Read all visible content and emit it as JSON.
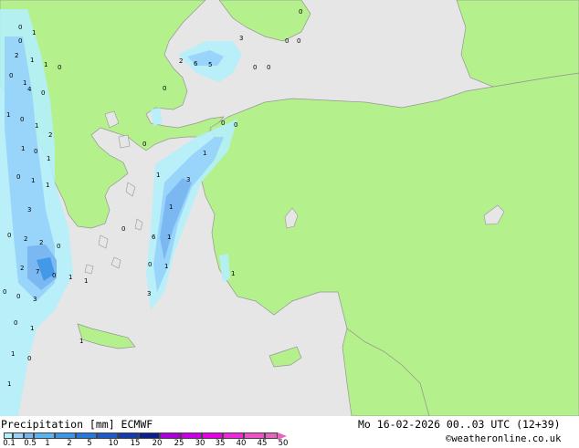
{
  "map": {
    "labels": [
      "0",
      "1",
      "0",
      "2",
      "1",
      "1",
      "0",
      "0",
      "1",
      "4",
      "0",
      "1",
      "0",
      "1",
      "2",
      "1",
      "0",
      "1",
      "0",
      "1",
      "1",
      "3",
      "0",
      "2",
      "2",
      "0",
      "2",
      "7",
      "0",
      "1",
      "1",
      "3",
      "0",
      "0",
      "0",
      "1",
      "1",
      "1",
      "0",
      "1",
      "1",
      "3",
      "1",
      "6",
      "1",
      "1",
      "0",
      "1",
      "3",
      "2",
      "6",
      "5",
      "3",
      "0",
      "0",
      "0",
      "0",
      "0",
      "0",
      "0",
      "0",
      "0",
      "0",
      "1"
    ]
  },
  "footer": {
    "title": "Precipitation [mm] ECMWF",
    "datetime": "Mo 16-02-2026 00..03 UTC (12+39)",
    "credit": "©weatheronline.co.uk",
    "legend_labels": [
      "0.1",
      "0.5",
      "1",
      "2",
      "5",
      "10",
      "15",
      "20",
      "25",
      "30",
      "35",
      "40",
      "45",
      "50"
    ],
    "legend_colors": [
      "#b4f0fa",
      "#96d2fa",
      "#78b4f0",
      "#5ab4f0",
      "#3c96e6",
      "#2878dc",
      "#1e5ac8",
      "#143caa",
      "#0a1e8c",
      "#aa00dc",
      "#c800e6",
      "#e600e6",
      "#f028dc",
      "#f050c8",
      "#e664be"
    ]
  }
}
